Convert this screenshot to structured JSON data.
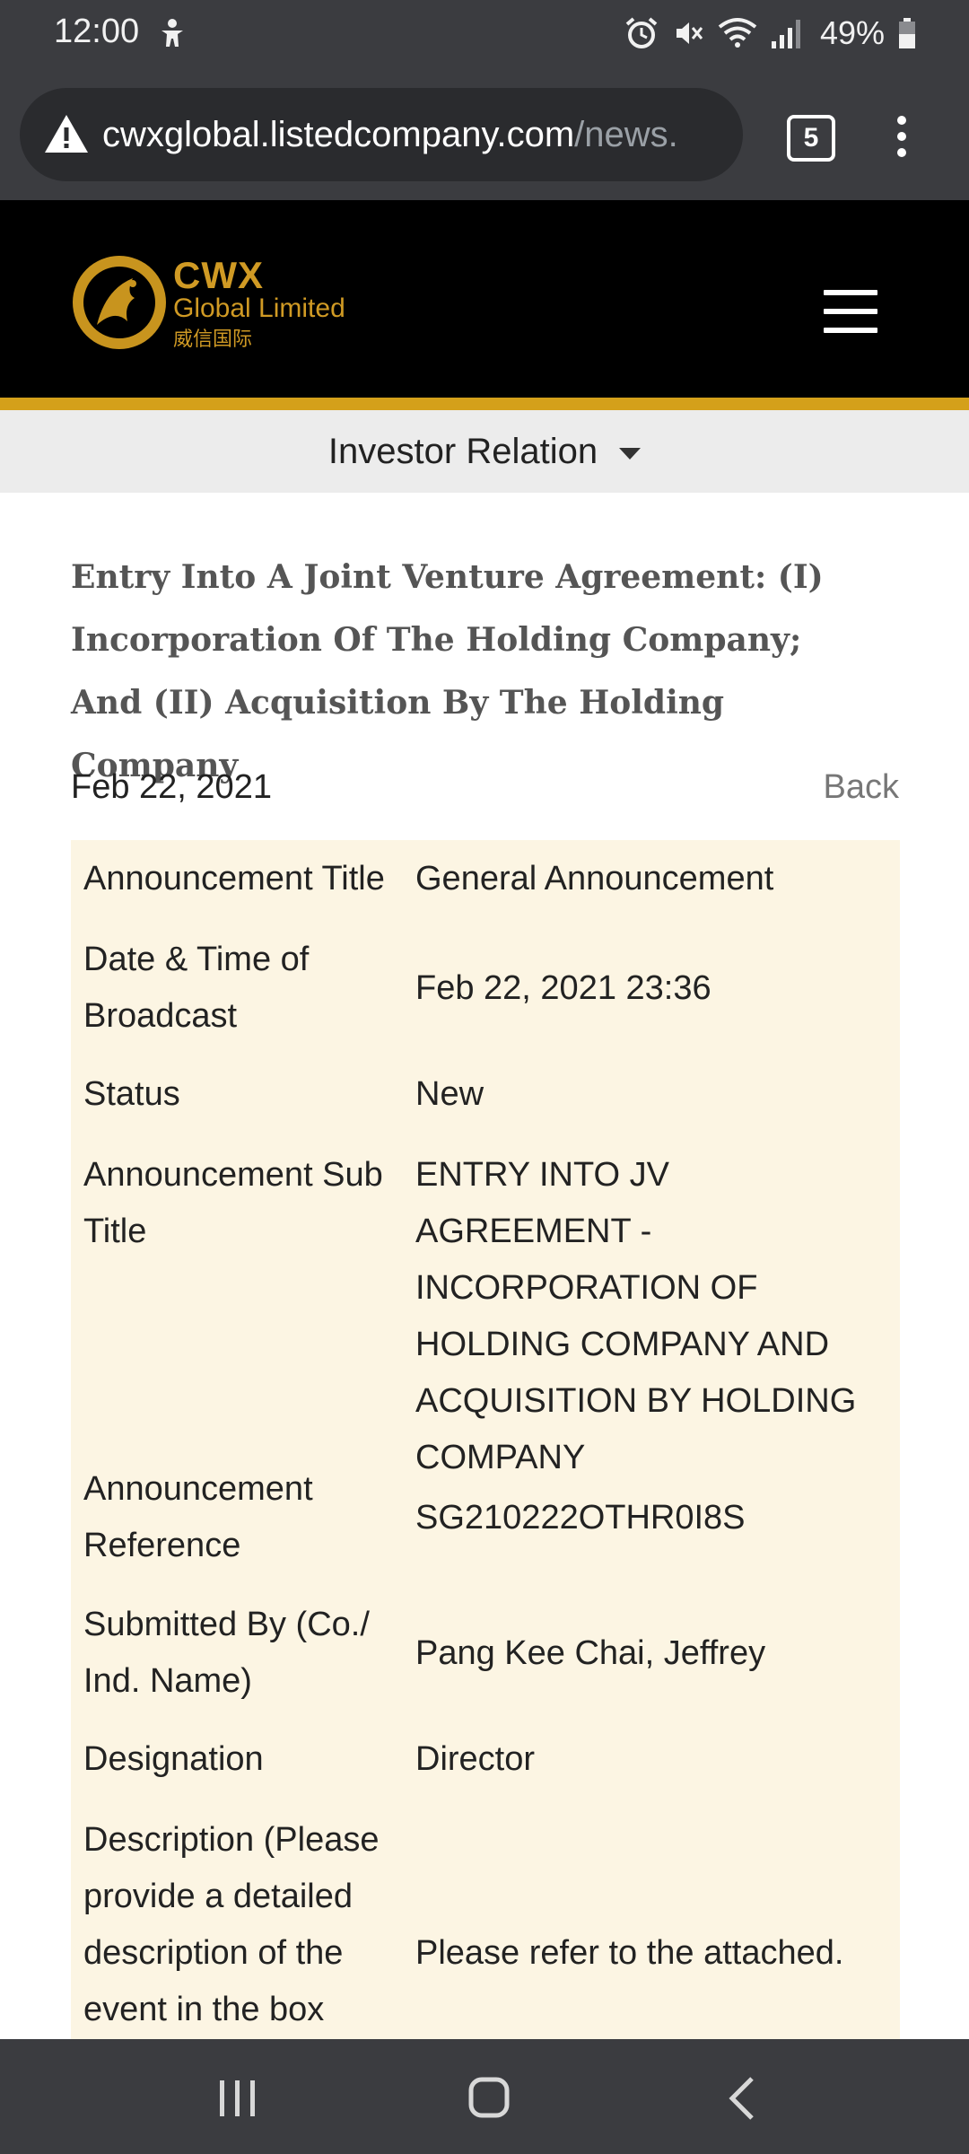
{
  "status_bar": {
    "time": "12:00",
    "battery": "49%",
    "icons": [
      "accessibility-icon",
      "alarm-icon",
      "mute-icon",
      "wifi-icon",
      "signal-icon",
      "battery-icon"
    ]
  },
  "browser": {
    "url_host": "cwxglobal.listedcompany.com",
    "url_path": "/news.",
    "tab_count": "5"
  },
  "site": {
    "brand_name": "CWX",
    "brand_sub": "Global Limited",
    "brand_cn": "威信国际",
    "section_dropdown": "Investor Relation"
  },
  "article": {
    "title": "Entry Into A Joint Venture Agreement: (I) Incorporation Of The Holding Company; And (II) Acquisition By The Holding Company",
    "date": "Feb 22, 2021",
    "back_label": "Back"
  },
  "details": [
    {
      "label": "Announcement Title",
      "value": "General Announcement"
    },
    {
      "label": "Date & Time of Broadcast",
      "value": "Feb 22, 2021 23:36"
    },
    {
      "label": "Status",
      "value": "New"
    },
    {
      "label": "Announcement Sub Title",
      "value": "ENTRY INTO JV AGREEMENT - INCORPORATION OF HOLDING COMPANY AND ACQUISITION BY HOLDING COMPANY"
    },
    {
      "label": "Announcement Reference",
      "value": "SG210222OTHR0I8S"
    },
    {
      "label": "Submitted By (Co./ Ind. Name)",
      "value": "Pang Kee Chai, Jeffrey"
    },
    {
      "label": "Designation",
      "value": "Director"
    },
    {
      "label": "Description (Please provide a detailed description of the event in the box",
      "value": "Please refer to the attached."
    }
  ],
  "colors": {
    "brand_gold": "#d09a24",
    "table_bg": "#fcf5e3",
    "header_bg": "#000000"
  }
}
